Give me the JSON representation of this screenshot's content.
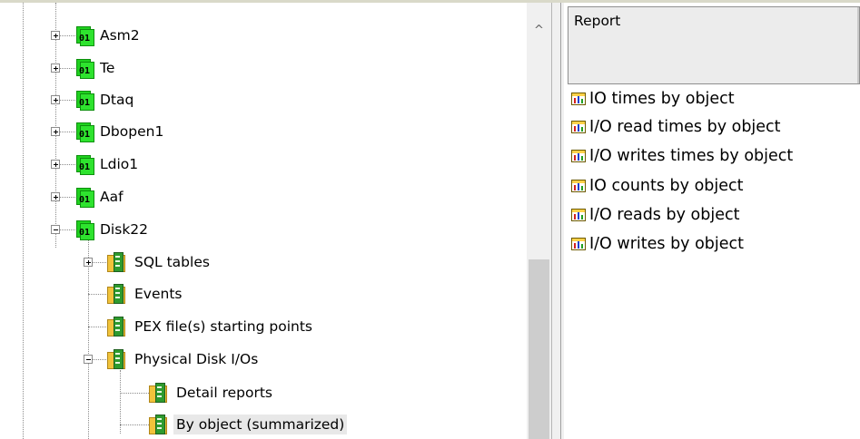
{
  "tree": {
    "nodes": [
      {
        "label": "Asm2",
        "icon": "database-member-icon",
        "expander": "plus"
      },
      {
        "label": "Te",
        "icon": "database-member-icon",
        "expander": "plus"
      },
      {
        "label": "Dtaq",
        "icon": "database-member-icon",
        "expander": "plus"
      },
      {
        "label": "Dbopen1",
        "icon": "database-member-icon",
        "expander": "plus"
      },
      {
        "label": "Ldio1",
        "icon": "database-member-icon",
        "expander": "plus"
      },
      {
        "label": "Aaf",
        "icon": "database-member-icon",
        "expander": "plus"
      },
      {
        "label": "Disk22",
        "icon": "database-member-icon",
        "expander": "minus"
      },
      {
        "label": "SQL tables",
        "icon": "folder-document-icon",
        "expander": "plus"
      },
      {
        "label": "Events",
        "icon": "folder-document-icon",
        "expander": "none"
      },
      {
        "label": "PEX file(s) starting points",
        "icon": "folder-document-icon",
        "expander": "none"
      },
      {
        "label": "Physical Disk I/Os",
        "icon": "folder-document-icon",
        "expander": "minus"
      },
      {
        "label": "Detail reports",
        "icon": "folder-document-icon",
        "expander": "none"
      },
      {
        "label": "By object (summarized)",
        "icon": "folder-document-icon",
        "expander": "none",
        "selected": true
      }
    ],
    "db_icon_text": "01"
  },
  "right_panel": {
    "header": "Report",
    "items": [
      "IO times by object",
      "I/O read times by object",
      "I/O writes times by object",
      "IO counts by object",
      "I/O reads by object",
      "I/O writes by object"
    ],
    "item_icon": "bar-chart-icon"
  },
  "scrollbar": {
    "up_arrow": "^"
  },
  "colors": {
    "selected_bg": "#e8e8e8",
    "db_icon_green": "#1fd11f",
    "folder_yellow": "#f1c33b",
    "chart_icon_yellow": "#ffd24a"
  }
}
